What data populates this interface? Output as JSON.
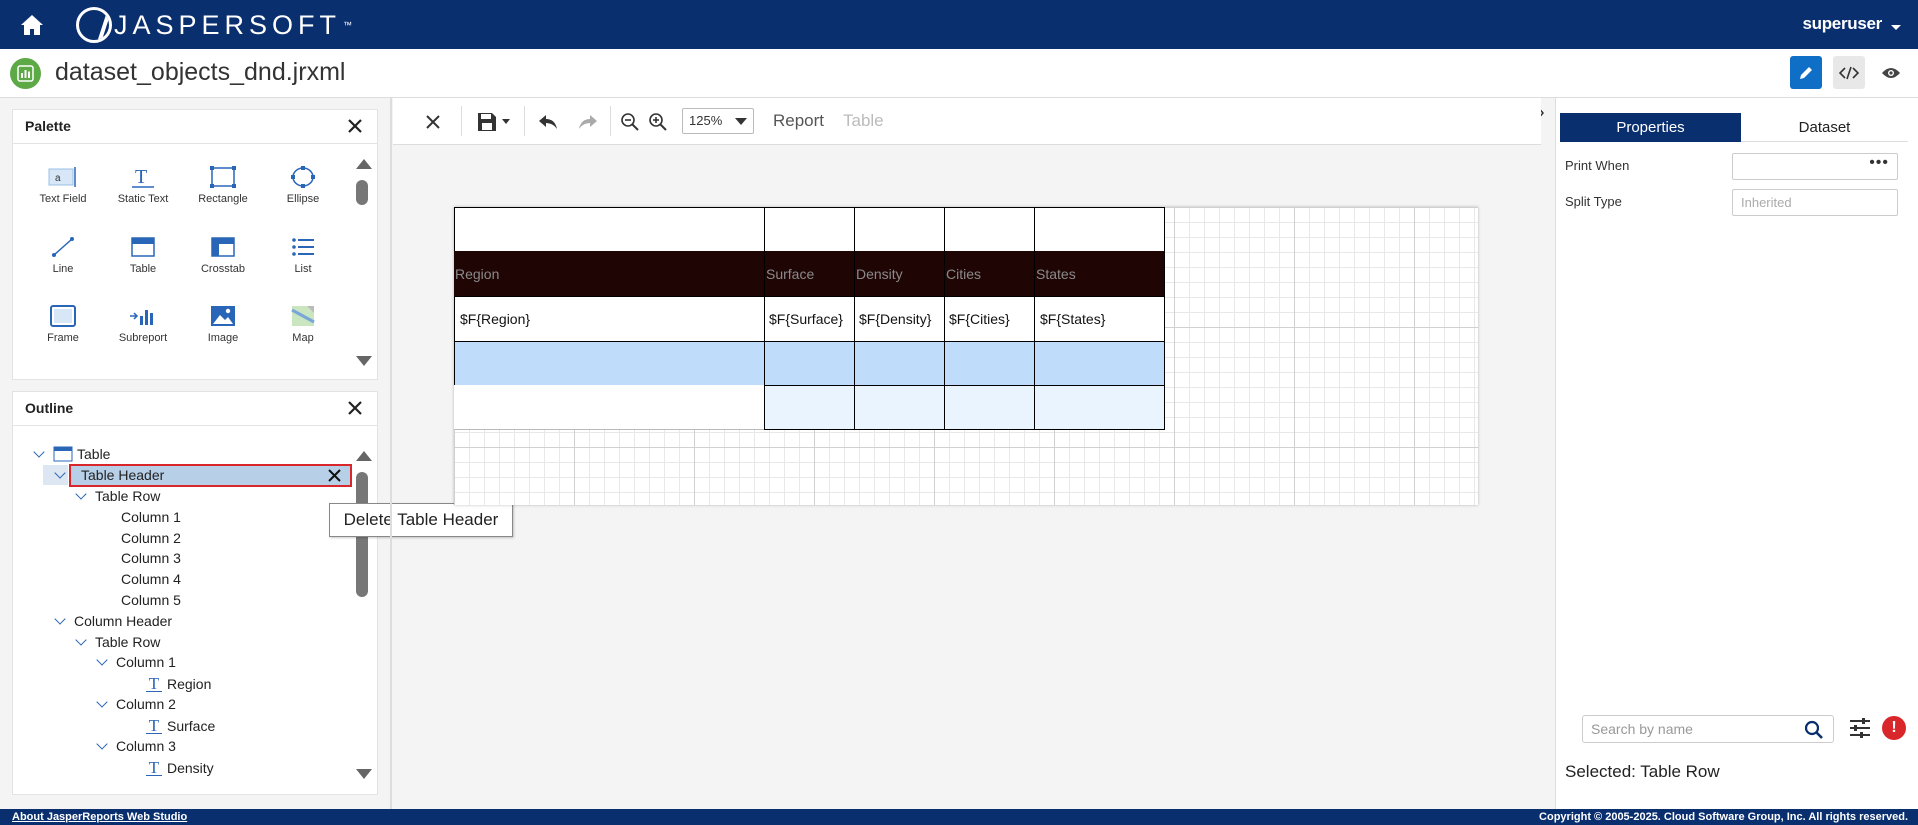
{
  "header": {
    "brand": "JASPERSOFT",
    "brand_tm": "™",
    "user": "superuser"
  },
  "file": {
    "title": "dataset_objects_dnd.jrxml"
  },
  "palette": {
    "title": "Palette",
    "items": [
      {
        "label": "Text Field",
        "icon": "text-field-icon"
      },
      {
        "label": "Static Text",
        "icon": "static-text-icon"
      },
      {
        "label": "Rectangle",
        "icon": "rectangle-icon"
      },
      {
        "label": "Ellipse",
        "icon": "ellipse-icon"
      },
      {
        "label": "Line",
        "icon": "line-icon"
      },
      {
        "label": "Table",
        "icon": "table-icon"
      },
      {
        "label": "Crosstab",
        "icon": "crosstab-icon"
      },
      {
        "label": "List",
        "icon": "list-icon"
      },
      {
        "label": "Frame",
        "icon": "frame-icon"
      },
      {
        "label": "Subreport",
        "icon": "subreport-icon"
      },
      {
        "label": "Image",
        "icon": "image-icon"
      },
      {
        "label": "Map",
        "icon": "map-icon"
      }
    ]
  },
  "outline": {
    "title": "Outline",
    "nodes": [
      {
        "label": "Table",
        "level": 0
      },
      {
        "label": "Table Header",
        "level": 1,
        "selected": true
      },
      {
        "label": "Table Row",
        "level": 2
      },
      {
        "label": "Column 1",
        "level": 3
      },
      {
        "label": "Column 2",
        "level": 3
      },
      {
        "label": "Column 3",
        "level": 3
      },
      {
        "label": "Column 4",
        "level": 3
      },
      {
        "label": "Column 5",
        "level": 3
      },
      {
        "label": "Column Header",
        "level": 1
      },
      {
        "label": "Table Row",
        "level": 2
      },
      {
        "label": "Column 1",
        "level": 3
      },
      {
        "label": "Region",
        "level": 4
      },
      {
        "label": "Column 2",
        "level": 3
      },
      {
        "label": "Surface",
        "level": 4
      },
      {
        "label": "Column 3",
        "level": 3
      },
      {
        "label": "Density",
        "level": 4
      }
    ]
  },
  "tooltip": "Delete Table Header",
  "toolbar": {
    "zoom": "125%",
    "crumb_report": "Report",
    "crumb_table": "Table"
  },
  "table": {
    "headers": [
      "Region",
      "Surface",
      "Density",
      "Cities",
      "States"
    ],
    "fields": [
      "$F{Region}",
      "$F{Surface}",
      "$F{Density}",
      "$F{Cities}",
      "$F{States}"
    ]
  },
  "properties": {
    "tabs": [
      "Properties",
      "Dataset"
    ],
    "print_when_label": "Print When",
    "split_type_label": "Split Type",
    "split_type_placeholder": "Inherited",
    "search_placeholder": "Search by name",
    "selected": "Selected: Table Row"
  },
  "footer": {
    "about": "About JasperReports Web Studio",
    "copyright": "Copyright © 2005-2025. Cloud Software Group, Inc. All rights reserved."
  },
  "colors": {
    "brand": "#0a2f6f",
    "accent": "#0f6fc6",
    "header_band": "#200505",
    "detail_band": "#bfdcfb",
    "selected_outline": "#d8262b"
  }
}
